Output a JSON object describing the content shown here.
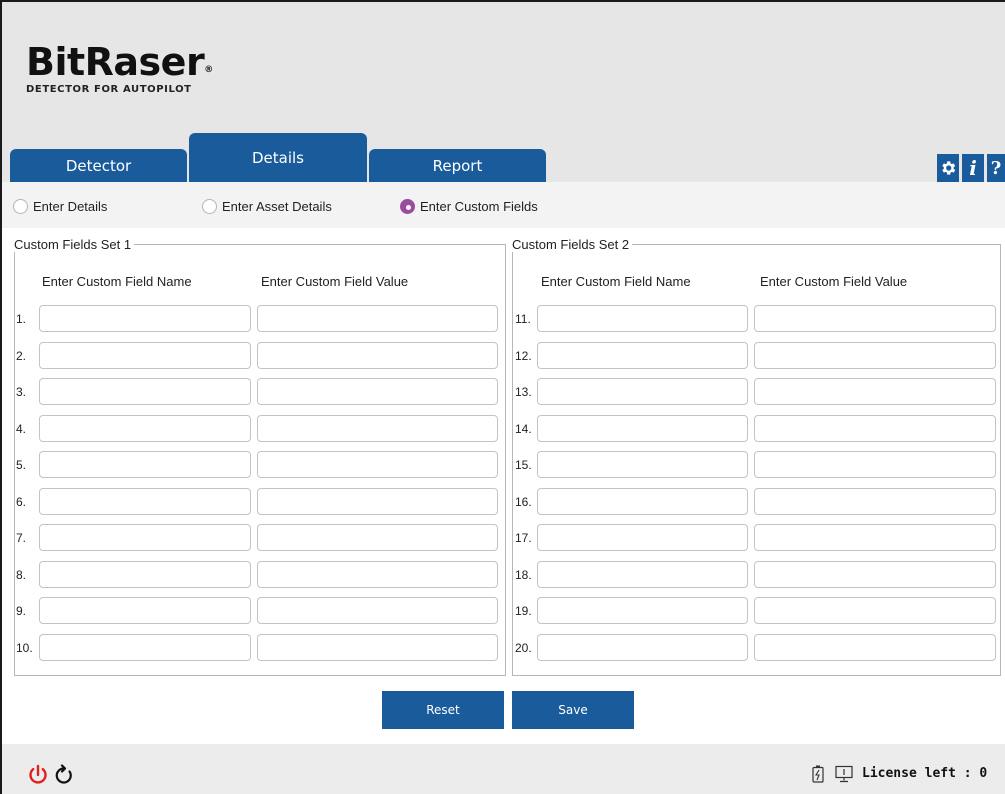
{
  "logo": {
    "word": "BitRaser",
    "registered": "®",
    "tagline": "DETECTOR FOR AUTOPILOT"
  },
  "tabs": [
    {
      "label": "Detector",
      "active": false
    },
    {
      "label": "Details",
      "active": true
    },
    {
      "label": "Report",
      "active": false
    }
  ],
  "header_icons": [
    "gear-icon",
    "info-icon",
    "help-icon"
  ],
  "header_icon_glyphs": {
    "info": "i",
    "help": "?"
  },
  "radios": [
    {
      "label": "Enter Details",
      "selected": false
    },
    {
      "label": "Enter Asset Details",
      "selected": false
    },
    {
      "label": "Enter Custom Fields",
      "selected": true
    }
  ],
  "set1": {
    "legend": "Custom Fields Set 1",
    "col_name": "Enter Custom Field Name",
    "col_value": "Enter Custom Field Value",
    "rows": [
      "1.",
      "2.",
      "3.",
      "4.",
      "5.",
      "6.",
      "7.",
      "8.",
      "9.",
      "10."
    ]
  },
  "set2": {
    "legend": "Custom Fields Set 2",
    "col_name": "Enter Custom Field Name",
    "col_value": "Enter Custom Field Value",
    "rows": [
      "11.",
      "12.",
      "13.",
      "14.",
      "15.",
      "16.",
      "17.",
      "18.",
      "19.",
      "20."
    ]
  },
  "buttons": {
    "reset": "Reset",
    "save": "Save"
  },
  "footer": {
    "license_label": "License left : 0"
  },
  "colors": {
    "accent": "#1a5b9c",
    "radio_selected": "#9b4b9e",
    "power": "#e02020"
  }
}
